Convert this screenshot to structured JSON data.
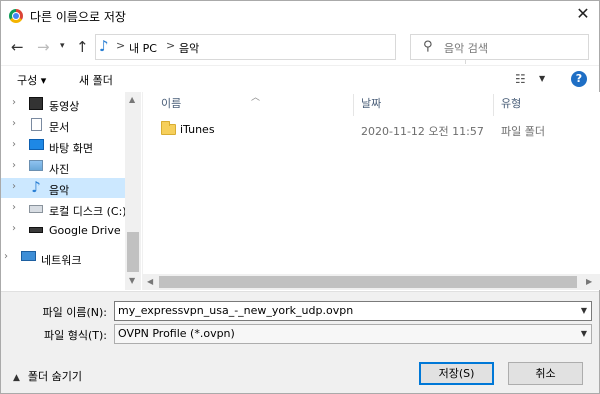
{
  "window": {
    "title": "다른 이름으로 저장",
    "close": "✕"
  },
  "nav": {
    "back": "←",
    "forward": "→",
    "recent": "▾",
    "up": "↑",
    "path": [
      "내 PC",
      "음악"
    ],
    "path_sep": ">",
    "refresh": "↻",
    "search_placeholder": "음악 검색"
  },
  "toolbar": {
    "organize": "구성 ▾",
    "new_folder": "새 폴더",
    "help": "?"
  },
  "sidebar": {
    "items": [
      {
        "label": "동영상",
        "icon": "video-icon"
      },
      {
        "label": "문서",
        "icon": "document-icon"
      },
      {
        "label": "바탕 화면",
        "icon": "desktop-icon"
      },
      {
        "label": "사진",
        "icon": "picture-icon"
      },
      {
        "label": "음악",
        "icon": "music-icon",
        "selected": true
      },
      {
        "label": "로컬 디스크 (C:)",
        "icon": "disk-icon"
      },
      {
        "label": "Google Drive (G",
        "icon": "drive-icon"
      },
      {
        "label": "네트워크",
        "icon": "network-icon"
      }
    ]
  },
  "columns": {
    "name": "이름",
    "date": "날짜",
    "type": "유형"
  },
  "files": [
    {
      "name": "iTunes",
      "date": "2020-11-12 오전 11:57",
      "type": "파일 폴더"
    }
  ],
  "form": {
    "filename_label": "파일 이름(N):",
    "filename_value": "my_expressvpn_usa_-_new_york_udp.ovpn",
    "filetype_label": "파일 형식(T):",
    "filetype_value": "OVPN Profile (*.ovpn)",
    "hide_folders": "폴더 숨기기",
    "save": "저장(S)",
    "cancel": "취소"
  },
  "colors": {
    "selection": "#cce8ff",
    "accent": "#0078d7"
  }
}
